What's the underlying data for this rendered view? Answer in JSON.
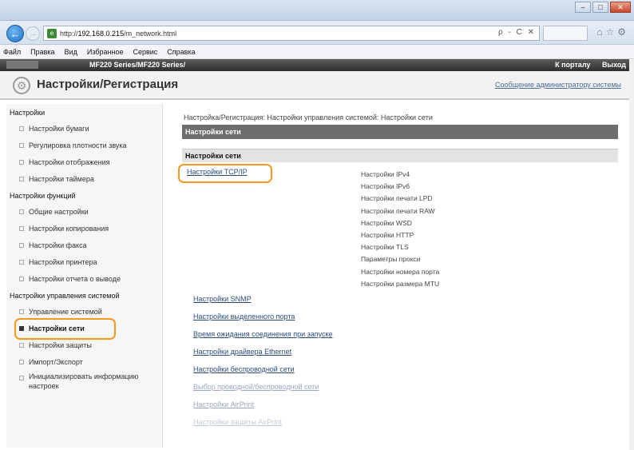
{
  "browser": {
    "url_prefix": "http://",
    "url_host": "192.168.0.215",
    "url_path": "/m_network.html",
    "search_hint": "ρ - C ✕",
    "window_controls": [
      "–",
      "□",
      "✕"
    ],
    "menu": [
      "Файл",
      "Правка",
      "Вид",
      "Избранное",
      "Сервис",
      "Справка"
    ]
  },
  "device": {
    "model": "MF220 Series/MF220 Series/",
    "portal_link": "К порталу",
    "logout_link": "Выход"
  },
  "header": {
    "title": "Настройки/Регистрация",
    "admin_message": "Сообщение администратору системы"
  },
  "sidebar": {
    "sections": [
      {
        "title": "Настройки",
        "items": [
          "Настройки бумаги",
          "Регулировка плотности звука",
          "Настройки отображения",
          "Настройки таймера"
        ]
      },
      {
        "title": "Настройки функций",
        "items": [
          "Общие настройки",
          "Настройки копирования",
          "Настройки факса",
          "Настройки принтера",
          "Настройки отчета о выводе"
        ]
      },
      {
        "title": "Настройки управления системой",
        "items": [
          "Управление системой",
          "Настройки сети",
          "Настройки защиты",
          "Импорт/Экспорт",
          "Инициализировать информацию настроек"
        ]
      }
    ],
    "active": "Настройки сети"
  },
  "main": {
    "breadcrumb": "Настройка/Регистрация: Настройки управления системой: Настройки сети",
    "bar_title": "Настройки сети",
    "section_title": "Настройки сети",
    "tcpip_link": "Настройки TCP/IP",
    "tcpip_sub": [
      "Настройки IPv4",
      "Настройки IPv6",
      "Настройки печати LPD",
      "Настройки печати RAW",
      "Настройки WSD",
      "Настройки HTTP",
      "Настройки TLS",
      "Параметры прокси",
      "Настройки номера порта",
      "Настройки размера MTU"
    ],
    "links": [
      "Настройки SNMP",
      "Настройки выделенного порта",
      "Время ожидания соединения при запуске",
      "Настройки драйвера Ethernet",
      "Настройки беспроводной сети",
      "Выбор проводной/беспроводной сети",
      "Настройки AirPrint",
      "Настройки защиты AirPrint"
    ]
  },
  "colors": {
    "highlight": "#f39a1f",
    "link": "#2b4d7e",
    "bar": "#6e6e6e"
  }
}
